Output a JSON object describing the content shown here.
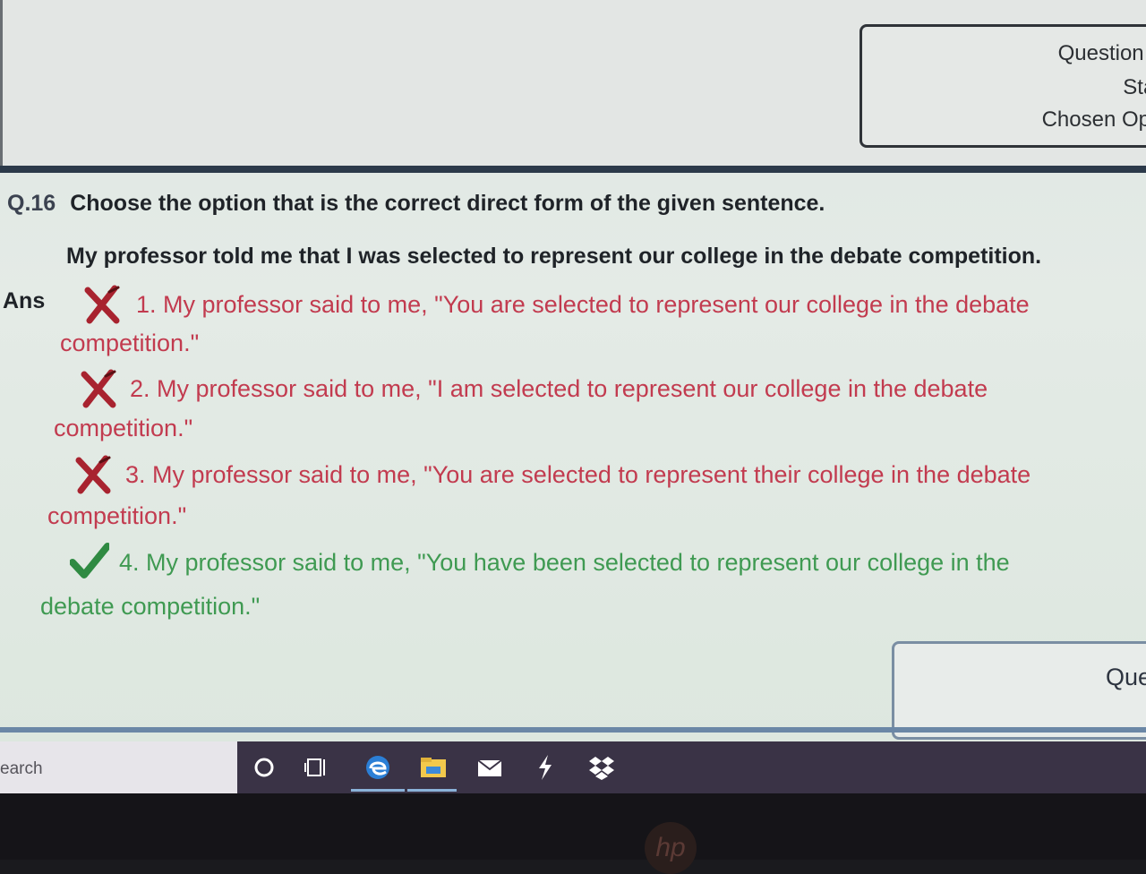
{
  "info_panel": {
    "question_label": "Question I",
    "status_label": "Stat",
    "chosen_label": "Chosen Opti"
  },
  "question": {
    "number": "Q.16",
    "prompt": "Choose the option that is the correct direct form of the given sentence.",
    "stem": "My professor told me that I was selected to represent our college in the debate competition.",
    "ans_label": "Ans"
  },
  "options": [
    {
      "line1": "1. My professor said to me, \"You are selected to represent our college in the debate",
      "line2": "competition.\"",
      "status": "wrong"
    },
    {
      "line1": "2. My professor said to me, \"I am selected to represent our college in the debate",
      "line2": "competition.\"",
      "status": "wrong"
    },
    {
      "line1": "3. My professor said to me, \"You are selected to represent their college in the debate",
      "line2": "competition.\"",
      "status": "wrong"
    },
    {
      "line1": "4. My professor said to me, \"You have been selected to represent our college in the",
      "line2": "debate competition.\"",
      "status": "correct"
    }
  ],
  "bottom_panel": {
    "label": "Que"
  },
  "taskbar": {
    "search_text": "earch",
    "icons": [
      "cortana-circle-icon",
      "task-view-icon",
      "edge-browser-icon",
      "file-explorer-icon",
      "mail-icon",
      "lightning-app-icon",
      "dropbox-icon"
    ]
  },
  "colors": {
    "wrong": "#c23b4f",
    "correct": "#3f9a52",
    "panel_border": "#2f3338",
    "taskbar": "#3a3346"
  }
}
